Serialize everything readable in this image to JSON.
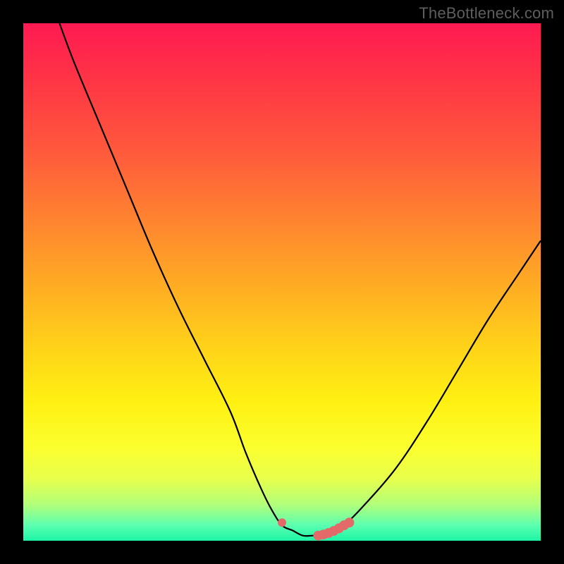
{
  "watermark": {
    "text": "TheBottleneck.com"
  },
  "colors": {
    "frame": "#000000",
    "curve": "#000000",
    "marker": "#e46a6a",
    "gradient_stops": [
      "#ff1a52",
      "#ff3246",
      "#ff5a3c",
      "#ff8a2e",
      "#ffb022",
      "#ffd419",
      "#fff012",
      "#fbff2e",
      "#e8ff4c",
      "#b2ff7a",
      "#5cffb0",
      "#1cf5a6"
    ]
  },
  "chart_data": {
    "type": "line",
    "title": "",
    "xlabel": "",
    "ylabel": "",
    "xlim": [
      0,
      100
    ],
    "ylim": [
      0,
      100
    ],
    "grid": false,
    "legend": false,
    "series": [
      {
        "name": "bottleneck-curve",
        "x": [
          7,
          10,
          15,
          20,
          25,
          30,
          35,
          40,
          43,
          46,
          48,
          50,
          52,
          54,
          56,
          58,
          60,
          62,
          66,
          72,
          78,
          84,
          90,
          96,
          100
        ],
        "y": [
          100,
          92,
          80,
          68,
          56,
          45,
          35,
          25,
          17,
          10,
          6,
          3,
          2,
          1,
          1,
          1,
          2,
          3,
          7,
          14,
          23,
          33,
          43,
          52,
          58
        ]
      }
    ],
    "markers": {
      "name": "highlight-dots",
      "color": "#e46a6a",
      "points": [
        {
          "x": 50,
          "y": 3.5
        },
        {
          "x": 57,
          "y": 1.0
        },
        {
          "x": 58,
          "y": 1.2
        },
        {
          "x": 59,
          "y": 1.5
        },
        {
          "x": 60,
          "y": 1.9
        },
        {
          "x": 61,
          "y": 2.4
        },
        {
          "x": 62,
          "y": 3.0
        },
        {
          "x": 63,
          "y": 3.5
        }
      ]
    }
  }
}
